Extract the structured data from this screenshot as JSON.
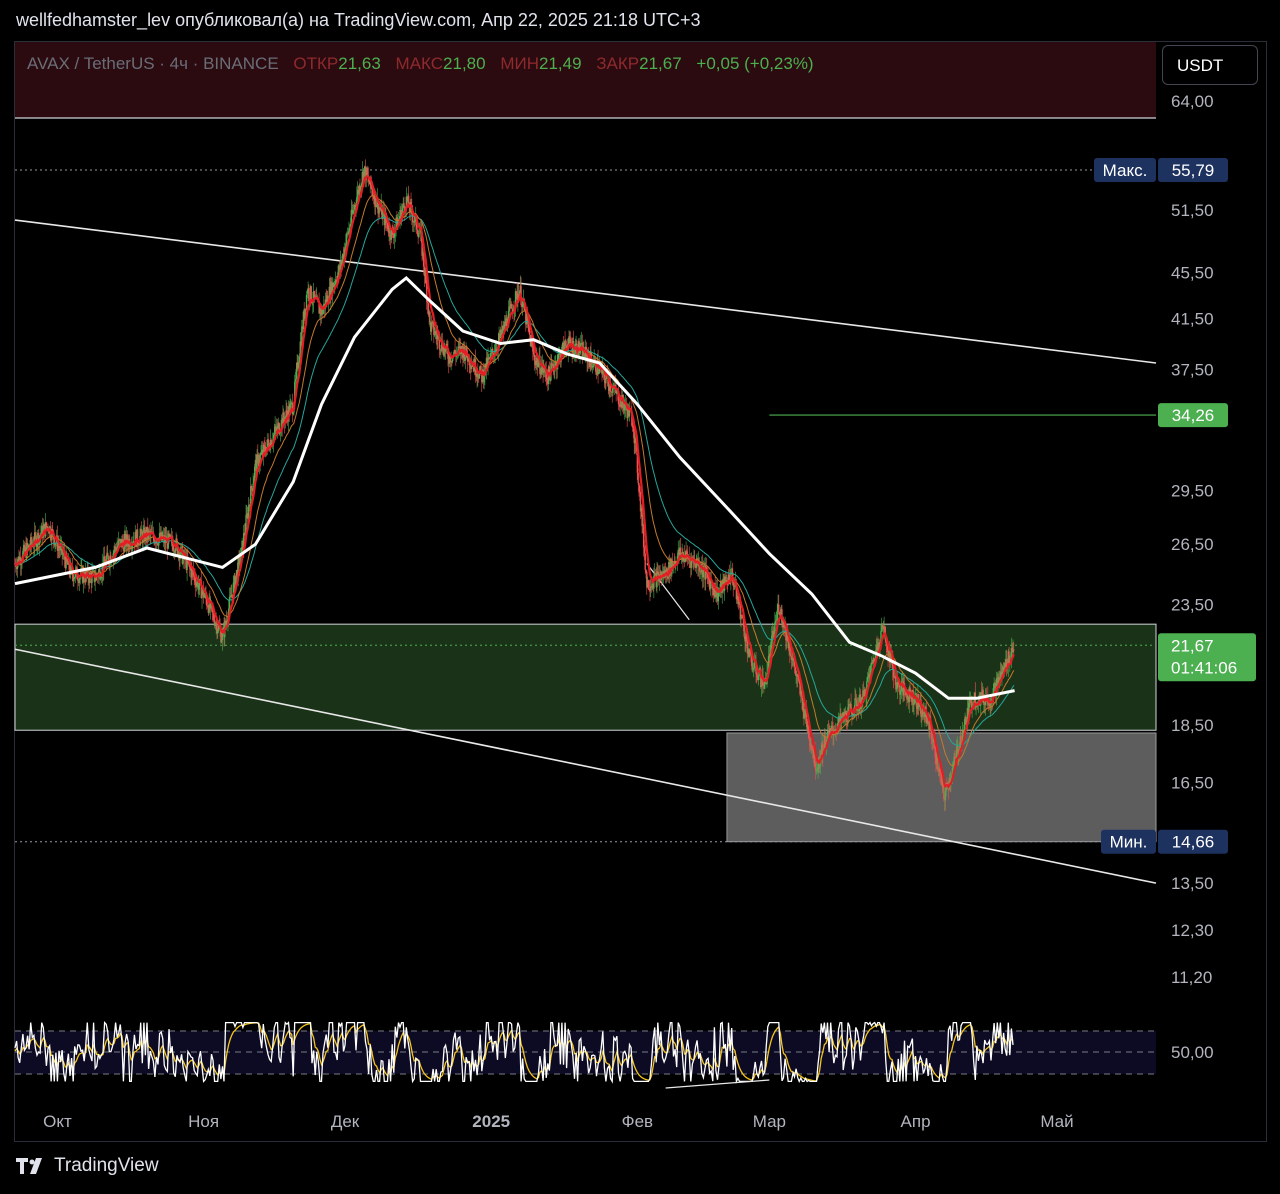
{
  "header": {
    "text": "wellfedhamster_lev опубликовал(а) на TradingView.com, Апр 22, 2025 21:18 UTC+3"
  },
  "legend": {
    "symbol": "AVAX / TetherUS · 4ч · BINANCE",
    "open_label": "ОТКР",
    "open": "21,63",
    "high_label": "МАКС",
    "high": "21,80",
    "low_label": "МИН",
    "low": "21,49",
    "close_label": "ЗАКР",
    "close": "21,67",
    "change": "+0,05 (+0,23%)"
  },
  "currency_button": "USDT",
  "footer": {
    "brand": "TradingView",
    "logo_icon": "tradingview-logo-icon"
  },
  "colors": {
    "background": "#000000",
    "up": "#4caf50",
    "down": "#ef5350",
    "zone_green": "#1a3318",
    "zone_grey": "#5d5d5d",
    "max_label_bg": "#1e3260",
    "price_label_bg": "#4caf50"
  },
  "chart_data": {
    "type": "candlestick",
    "scale": "log",
    "price_axis_ticks": [
      "64,00",
      "51,50",
      "45,50",
      "41,50",
      "37,50",
      "29,50",
      "26,50",
      "23,50",
      "18,50",
      "16,50",
      "13,50",
      "12,30",
      "11,20"
    ],
    "price_axis_tick_values": [
      64.0,
      51.5,
      45.5,
      41.5,
      37.5,
      29.5,
      26.5,
      23.5,
      18.5,
      16.5,
      13.5,
      12.3,
      11.2
    ],
    "time_axis_labels": [
      "Окт",
      "Ноя",
      "Дек",
      "2025",
      "Фев",
      "Мар",
      "Апр",
      "Май"
    ],
    "rsi_axis_label": "50,00",
    "markers": {
      "max": {
        "label": "Макс.",
        "value": "55,79"
      },
      "min": {
        "label": "Мин.",
        "value": "14,66"
      },
      "level": {
        "value": "34,26"
      },
      "last": {
        "value": "21,67",
        "countdown": "01:41:06"
      }
    },
    "zones": [
      {
        "name": "green-zone",
        "from": 18.3,
        "to": 22.6
      },
      {
        "name": "grey-zone",
        "from": 14.66,
        "to": 18.2
      }
    ],
    "price_path": [
      [
        "2024-09-22",
        25.5
      ],
      [
        "2024-09-29",
        27.5
      ],
      [
        "2024-10-04",
        25.0
      ],
      [
        "2024-10-09",
        24.8
      ],
      [
        "2024-10-14",
        26.5
      ],
      [
        "2024-10-20",
        27.0
      ],
      [
        "2024-10-26",
        26.5
      ],
      [
        "2024-11-01",
        24.0
      ],
      [
        "2024-11-05",
        22.0
      ],
      [
        "2024-11-09",
        26.0
      ],
      [
        "2024-11-12",
        31.0
      ],
      [
        "2024-11-16",
        33.0
      ],
      [
        "2024-11-20",
        35.0
      ],
      [
        "2024-11-23",
        44.0
      ],
      [
        "2024-11-26",
        42.0
      ],
      [
        "2024-11-30",
        46.0
      ],
      [
        "2024-12-03",
        52.0
      ],
      [
        "2024-12-05",
        55.8
      ],
      [
        "2024-12-08",
        52.0
      ],
      [
        "2024-12-11",
        49.0
      ],
      [
        "2024-12-14",
        52.5
      ],
      [
        "2024-12-17",
        49.0
      ],
      [
        "2024-12-19",
        41.0
      ],
      [
        "2024-12-23",
        38.5
      ],
      [
        "2024-12-26",
        39.0
      ],
      [
        "2024-12-30",
        37.0
      ],
      [
        "2025-01-03",
        40.0
      ],
      [
        "2025-01-07",
        44.0
      ],
      [
        "2025-01-10",
        38.5
      ],
      [
        "2025-01-13",
        37.0
      ],
      [
        "2025-01-17",
        39.5
      ],
      [
        "2025-01-20",
        39.0
      ],
      [
        "2025-01-24",
        37.5
      ],
      [
        "2025-01-27",
        36.0
      ],
      [
        "2025-01-31",
        34.0
      ],
      [
        "2025-02-03",
        24.5
      ],
      [
        "2025-02-07",
        25.0
      ],
      [
        "2025-02-10",
        26.0
      ],
      [
        "2025-02-14",
        25.5
      ],
      [
        "2025-02-18",
        24.0
      ],
      [
        "2025-02-21",
        25.0
      ],
      [
        "2025-02-25",
        21.0
      ],
      [
        "2025-02-28",
        20.0
      ],
      [
        "2025-03-03",
        23.5
      ],
      [
        "2025-03-06",
        21.0
      ],
      [
        "2025-03-09",
        18.5
      ],
      [
        "2025-03-11",
        17.0
      ],
      [
        "2025-03-13",
        18.0
      ],
      [
        "2025-03-17",
        18.8
      ],
      [
        "2025-03-21",
        19.5
      ],
      [
        "2025-03-25",
        22.5
      ],
      [
        "2025-03-28",
        20.0
      ],
      [
        "2025-04-01",
        19.5
      ],
      [
        "2025-04-04",
        18.5
      ],
      [
        "2025-04-07",
        16.0
      ],
      [
        "2025-04-09",
        17.0
      ],
      [
        "2025-04-13",
        19.5
      ],
      [
        "2025-04-17",
        19.5
      ],
      [
        "2025-04-22",
        21.67
      ]
    ],
    "ma_white_path": [
      [
        "2024-09-22",
        24.5
      ],
      [
        "2024-10-09",
        25.3
      ],
      [
        "2024-10-20",
        26.3
      ],
      [
        "2024-11-05",
        25.3
      ],
      [
        "2024-11-12",
        26.5
      ],
      [
        "2024-11-20",
        30.0
      ],
      [
        "2024-11-26",
        35.0
      ],
      [
        "2024-12-03",
        40.0
      ],
      [
        "2024-12-11",
        44.0
      ],
      [
        "2024-12-14",
        45.0
      ],
      [
        "2024-12-19",
        43.0
      ],
      [
        "2024-12-26",
        40.5
      ],
      [
        "2025-01-03",
        39.5
      ],
      [
        "2025-01-10",
        39.8
      ],
      [
        "2025-01-17",
        38.7
      ],
      [
        "2025-01-24",
        38.0
      ],
      [
        "2025-02-01",
        35.0
      ],
      [
        "2025-02-10",
        31.5
      ],
      [
        "2025-02-20",
        28.5
      ],
      [
        "2025-03-01",
        26.0
      ],
      [
        "2025-03-10",
        24.0
      ],
      [
        "2025-03-18",
        21.8
      ],
      [
        "2025-03-25",
        21.2
      ],
      [
        "2025-04-01",
        20.5
      ],
      [
        "2025-04-08",
        19.5
      ],
      [
        "2025-04-14",
        19.5
      ],
      [
        "2025-04-22",
        19.8
      ]
    ],
    "rsi": {
      "upper": 70,
      "mid": 50,
      "lower": 30,
      "divergence_line": [
        [
          "2025-02-07",
          -1
        ],
        [
          "2025-03-01",
          -1
        ]
      ]
    },
    "trendlines": [
      {
        "name": "upper-channel",
        "from": [
          "2024-09-22",
          50.5
        ],
        "to": [
          "2025-05-22",
          38.0
        ]
      },
      {
        "name": "lower-channel",
        "from": [
          "2024-09-22",
          21.5
        ],
        "to": [
          "2025-05-22",
          13.5
        ]
      }
    ],
    "grid": false,
    "legend_position": "top-left"
  }
}
